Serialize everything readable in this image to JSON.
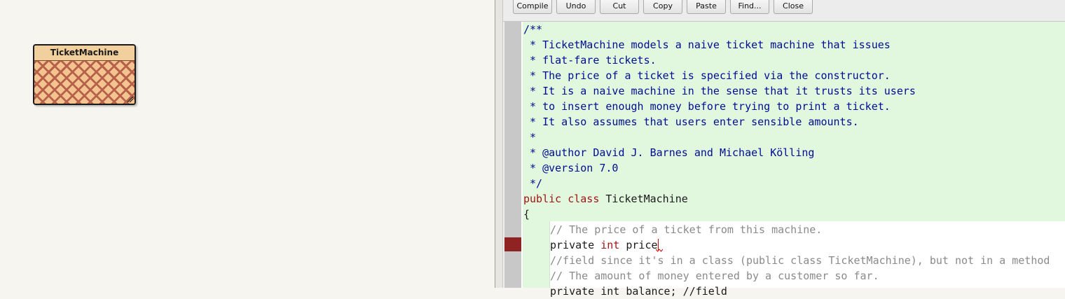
{
  "diagram": {
    "class_name": "TicketMachine"
  },
  "toolbar": {
    "buttons": [
      "Compile",
      "Undo",
      "Cut",
      "Copy",
      "Paste",
      "Find...",
      "Close"
    ]
  },
  "editor": {
    "lines": {
      "l1": "/**",
      "l2": " * TicketMachine models a naive ticket machine that issues",
      "l3": " * flat-fare tickets.",
      "l4": " * The price of a ticket is specified via the constructor.",
      "l5": " * It is a naive machine in the sense that it trusts its users",
      "l6": " * to insert enough money before trying to print a ticket.",
      "l7": " * It also assumes that users enter sensible amounts.",
      "l8": " *",
      "l9": " * @author David J. Barnes and Michael Kölling",
      "l10": " * @version 7.0",
      "l11": " */",
      "l12_kw1": "public",
      "l12_kw2": "class",
      "l12_name": "TicketMachine",
      "l13": "{",
      "l14": "// The price of a ticket from this machine.",
      "l15_kw1": "private",
      "l15_kw2": "int",
      "l15_name": "price",
      "l16": "//field since it's in a class (public class TicketMachine), but not in a method",
      "l17": "// The amount of money entered by a customer so far.",
      "l18": "private int balance; //field"
    }
  },
  "colors": {
    "code_background": "#e1f8de",
    "comment": "#000c94",
    "keyword": "#a01414",
    "breakpoint": "#8f2323"
  }
}
